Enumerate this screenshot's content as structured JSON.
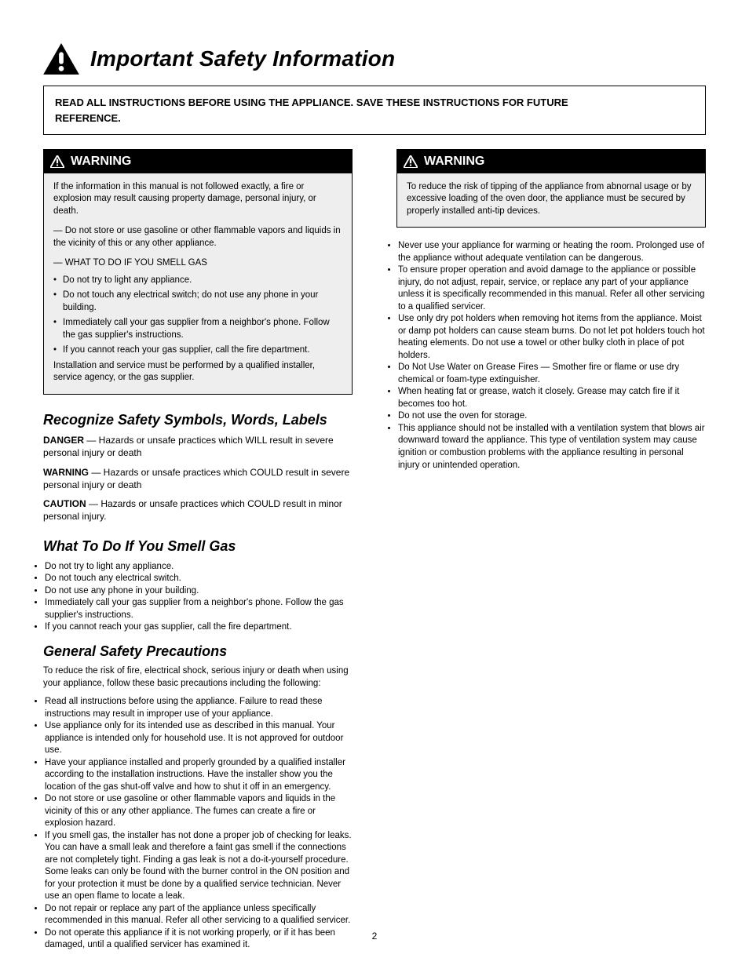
{
  "main_heading": "Important Safety Information",
  "intro": {
    "line1": "READ ALL INSTRUCTIONS BEFORE USING THE APPLIANCE. SAVE THESE INSTRUCTIONS FOR FUTURE",
    "line2": "REFERENCE."
  },
  "warnings": {
    "w1": {
      "label": "WARNING",
      "p1": "If the information in this manual is not followed exactly, a fire or explosion may result causing property damage, personal injury, or death.",
      "list_intro": "— Do not store or use gasoline or other flammable vapors and liquids in the vicinity of this or any other appliance.",
      "what_to_do": "— WHAT TO DO IF YOU SMELL GAS",
      "items": [
        "Do not try to light any appliance.",
        "Do not touch any electrical switch; do not use any phone in your building.",
        "Immediately call your gas supplier from a neighbor's phone. Follow the gas supplier's instructions.",
        "If you cannot reach your gas supplier, call the fire department."
      ],
      "p_last": "Installation and service must be performed by a qualified installer, service agency, or the gas supplier."
    },
    "w2": {
      "label": "WARNING",
      "p1": "To reduce the risk of tipping of the appliance from abnornal usage or by excessive loading of the oven door, the appliance must be secured by properly installed anti-tip devices."
    }
  },
  "recognize": {
    "title": "Recognize Safety Symbols, Words, Labels",
    "definitions": [
      {
        "term": "DANGER",
        "desc": " — Hazards or unsafe practices which WILL result in severe personal injury or death"
      },
      {
        "term": "WARNING",
        "desc": " — Hazards or unsafe practices which COULD result in severe personal injury or death"
      },
      {
        "term": "CAUTION",
        "desc": " — Hazards or unsafe practices which COULD result in minor personal injury."
      }
    ]
  },
  "what_to_do": {
    "title": "What To Do If You Smell Gas",
    "items": [
      "Do not try to light any appliance.",
      "Do not touch any electrical switch.",
      "Do not use any phone in your building.",
      "Immediately call your gas supplier from a neighbor's phone. Follow the gas supplier's instructions.",
      "If you cannot reach your gas supplier, call the fire department."
    ]
  },
  "general": {
    "title": "General Safety Precautions",
    "p1": "To reduce the risk of fire, electrical shock, serious injury or death when using your appliance, follow these basic precautions including the following:",
    "items": [
      {
        "label": "Read all instructions before using the appliance.",
        "text": " Failure to read these instructions may result in improper use of your appliance."
      },
      {
        "label": "Use appliance only for its intended use",
        "text": " as described in this manual. Your appliance is intended only for household use. It is not approved for outdoor use."
      },
      {
        "label": "Have your appliance installed and properly grounded by a qualified installer",
        "text": " according to the installation instructions. Have the installer show you the location of the gas shut-off valve and how to shut it off in an emergency."
      },
      {
        "label": "Do not store or use gasoline or other flammable vapors and liquids",
        "text": " in the vicinity of this or any other appliance. The fumes can create a fire or explosion hazard."
      },
      {
        "label": "If you smell gas, the installer has not done a proper job of checking for leaks.",
        "text": " You can have a small leak and therefore a faint gas smell if the connections are not completely tight. Finding a gas leak is not a do-it-yourself procedure. Some leaks can only be found with the burner control in the ON position and for your protection it must be done by a qualified service technician. Never use an open flame to locate a leak."
      },
      {
        "label": "Do not repair or replace any part of the appliance",
        "text": " unless specifically recommended in this manual. Refer all other servicing to a qualified servicer."
      },
      {
        "label": "Do not operate this appliance if it is not working properly,",
        "text": " or if it has been damaged, until a qualified servicer has examined it."
      },
      {
        "label": "Never use your appliance for warming or heating the room.",
        "text": " Prolonged use of the appliance without adequate ventilation can be dangerous."
      },
      {
        "label": "To ensure proper operation and avoid damage to the appliance or possible injury,",
        "text": " do not adjust, repair, service, or replace any part of your appliance unless it is specifically recommended in this manual. Refer all other servicing to a qualified servicer."
      },
      {
        "label": "Use only dry pot holders when removing hot items from the appliance.",
        "text": " Moist or damp pot holders can cause steam burns. Do not let pot holders touch hot heating elements. Do not use a towel or other bulky cloth in place of pot holders."
      },
      {
        "label": "Do Not Use Water on Grease Fires",
        "text": " — Smother fire or flame or use dry chemical or foam-type extinguisher."
      },
      {
        "label": "When heating fat or grease,",
        "text": " watch it closely. Grease may catch fire if it becomes too hot."
      },
      {
        "label": "Do not use the oven for storage.",
        "text": ""
      },
      {
        "label": "This appliance should not be installed with a ventilation system that blows air downward",
        "text": " toward the appliance. This type of ventilation system may cause ignition or combustion problems with the appliance resulting in personal injury or unintended operation."
      }
    ]
  },
  "page_number": "2"
}
